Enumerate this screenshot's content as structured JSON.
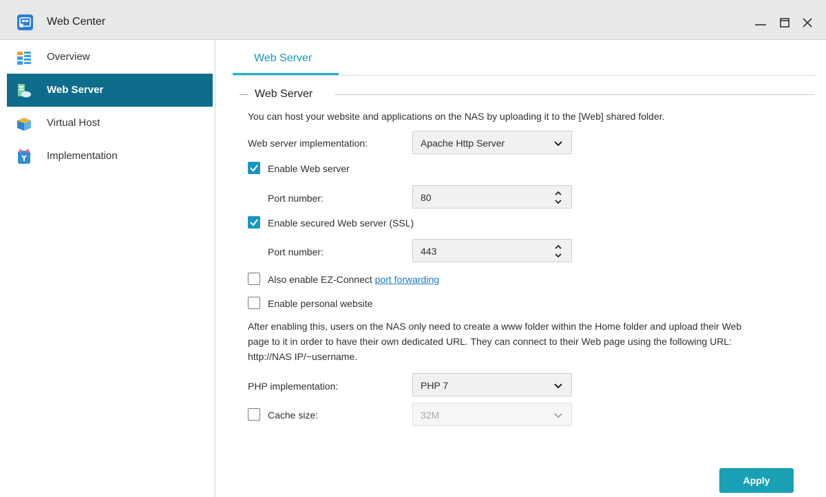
{
  "window": {
    "title": "Web Center",
    "minimize_icon": "minimize-icon",
    "maximize_icon": "maximize-icon",
    "close_icon": "close-icon"
  },
  "sidebar": {
    "items": [
      {
        "label": "Overview",
        "icon": "overview-icon",
        "active": false
      },
      {
        "label": "Web Server",
        "icon": "web-server-icon",
        "active": true
      },
      {
        "label": "Virtual Host",
        "icon": "virtual-host-icon",
        "active": false
      },
      {
        "label": "Implementation",
        "icon": "implementation-icon",
        "active": false
      }
    ]
  },
  "tabs": [
    {
      "label": "Web Server",
      "active": true
    }
  ],
  "section": {
    "title": "Web Server",
    "description": "You can host your website and applications on the NAS by uploading it to the [Web] shared folder."
  },
  "form": {
    "implementation_label": "Web server implementation:",
    "implementation_value": "Apache Http Server",
    "enable_web": {
      "label": "Enable Web server",
      "checked": true
    },
    "port_label": "Port number:",
    "port_value": "80",
    "enable_ssl": {
      "label": "Enable secured Web server (SSL)",
      "checked": true
    },
    "ssl_port_label": "Port number:",
    "ssl_port_value": "443",
    "ez_connect": {
      "label": "Also enable EZ-Connect ",
      "link": "port forwarding",
      "checked": false
    },
    "personal": {
      "label": "Enable personal website",
      "checked": false
    },
    "personal_note_line1": "After enabling this, users on the NAS only need to create a www folder within the Home folder and upload their Web",
    "personal_note_line2": "page to it in order to have their own dedicated URL. They can connect to their Web page using the following URL:",
    "personal_note_line3": "http://NAS IP/~username.",
    "php_label": "PHP implementation:",
    "php_value": "PHP 7",
    "cache": {
      "label": "Cache size:",
      "checked": false,
      "value": "32M"
    }
  },
  "actions": {
    "apply": "Apply"
  },
  "colors": {
    "accent": "#1aa0b5",
    "sidebar_active": "#0f6d8c",
    "checkbox_on": "#1796c4",
    "link": "#1a79c7"
  }
}
